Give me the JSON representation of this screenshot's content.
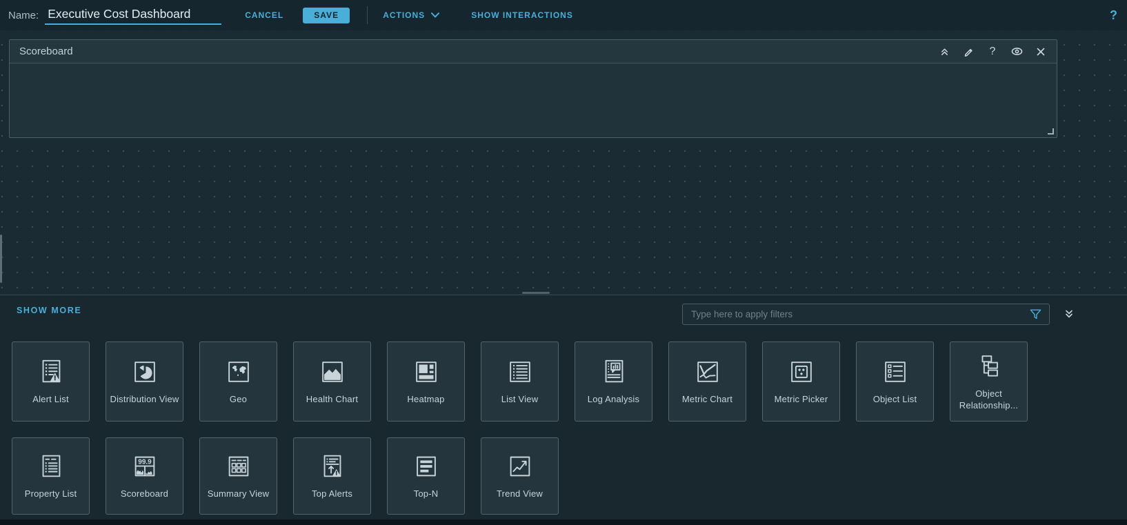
{
  "colors": {
    "accent": "#49afd9",
    "background": "#1b2b33",
    "panel": "#19282f",
    "tile": "#24353d",
    "border": "#4d5e66"
  },
  "topbar": {
    "name_label": "Name:",
    "name_value": "Executive Cost Dashboard",
    "cancel_label": "CANCEL",
    "save_label": "SAVE",
    "actions_label": "ACTIONS",
    "show_interactions_label": "SHOW INTERACTIONS",
    "help_icon": "?"
  },
  "canvas": {
    "widget": {
      "title": "Scoreboard",
      "toolbar": [
        "collapse-up-icon",
        "edit-icon",
        "help-icon",
        "show-hide-icon",
        "close-icon"
      ]
    }
  },
  "palette": {
    "show_more_label": "SHOW MORE",
    "filter_placeholder": "Type here to apply filters",
    "scoreboard_icon_value": "99.9",
    "widgets": [
      {
        "label": "Alert List",
        "icon": "alert-list"
      },
      {
        "label": "Distribution View",
        "icon": "distribution-view"
      },
      {
        "label": "Geo",
        "icon": "geo"
      },
      {
        "label": "Health Chart",
        "icon": "health-chart"
      },
      {
        "label": "Heatmap",
        "icon": "heatmap"
      },
      {
        "label": "List View",
        "icon": "list-view"
      },
      {
        "label": "Log Analysis",
        "icon": "log-analysis"
      },
      {
        "label": "Metric Chart",
        "icon": "metric-chart"
      },
      {
        "label": "Metric Picker",
        "icon": "metric-picker"
      },
      {
        "label": "Object List",
        "icon": "object-list"
      },
      {
        "label": "Object Relationship...",
        "icon": "object-relationship"
      },
      {
        "label": "Property List",
        "icon": "property-list"
      },
      {
        "label": "Scoreboard",
        "icon": "scoreboard"
      },
      {
        "label": "Summary View",
        "icon": "summary-view"
      },
      {
        "label": "Top Alerts",
        "icon": "top-alerts"
      },
      {
        "label": "Top-N",
        "icon": "top-n"
      },
      {
        "label": "Trend View",
        "icon": "trend-view"
      }
    ]
  }
}
